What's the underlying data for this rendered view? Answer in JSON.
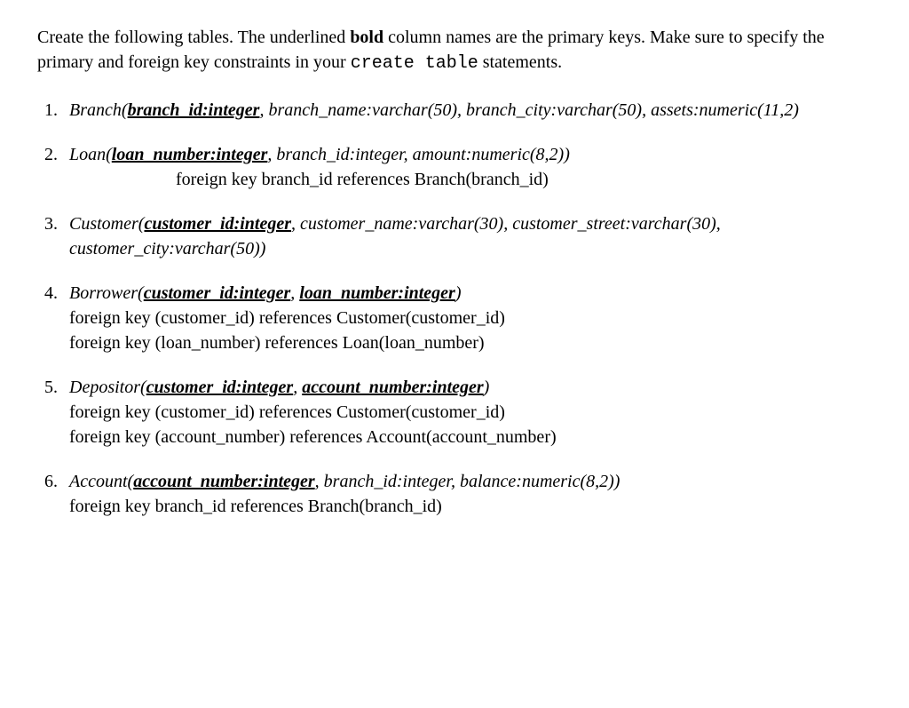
{
  "intro": {
    "part1": "Create the following tables. The underlined ",
    "bold_word": "bold",
    "part2": " column names are the primary keys. Make sure to specify the primary and foreign key constraints in your ",
    "mono1": "create table",
    "part3": " statements."
  },
  "items": [
    {
      "table": "Branch",
      "pk1": "branch_id:integer",
      "rest": ", branch_name:varchar(50), branch_city:varchar(50), assets:numeric(11,2)",
      "fk_lines": []
    },
    {
      "table": "Loan",
      "pk1": "loan_number:integer",
      "rest": ", branch_id:integer, amount:numeric(8,2))",
      "fk_lines": [
        {
          "text": "foreign key branch_id references Branch(branch_id)",
          "indent": true
        }
      ]
    },
    {
      "table": "Customer",
      "pk1": "customer_id:integer",
      "rest": ", customer_name:varchar(30), customer_street:varchar(30), customer_city:varchar(50))",
      "fk_lines": []
    },
    {
      "table": "Borrower",
      "pk1": "customer_id:integer",
      "mid": ", ",
      "pk2": "loan_number:integer",
      "close": ")",
      "fk_lines": [
        {
          "text": "foreign key (customer_id) references Customer(customer_id)",
          "indent": false
        },
        {
          "text": "foreign key (loan_number) references Loan(loan_number)",
          "indent": false
        }
      ]
    },
    {
      "table": "Depositor",
      "pk1": "customer_id:integer",
      "mid": ", ",
      "pk2": "account_number:integer",
      "close": ")",
      "fk_lines": [
        {
          "text": "foreign key (customer_id) references Customer(customer_id)",
          "indent": false
        },
        {
          "text": "foreign key (account_number) references Account(account_number)",
          "indent": false
        }
      ]
    },
    {
      "table": "Account",
      "pk1": "account_number:integer",
      "rest": ", branch_id:integer, balance:numeric(8,2))",
      "fk_lines": [
        {
          "text": "foreign key branch_id references Branch(branch_id)",
          "indent": false
        }
      ]
    }
  ]
}
